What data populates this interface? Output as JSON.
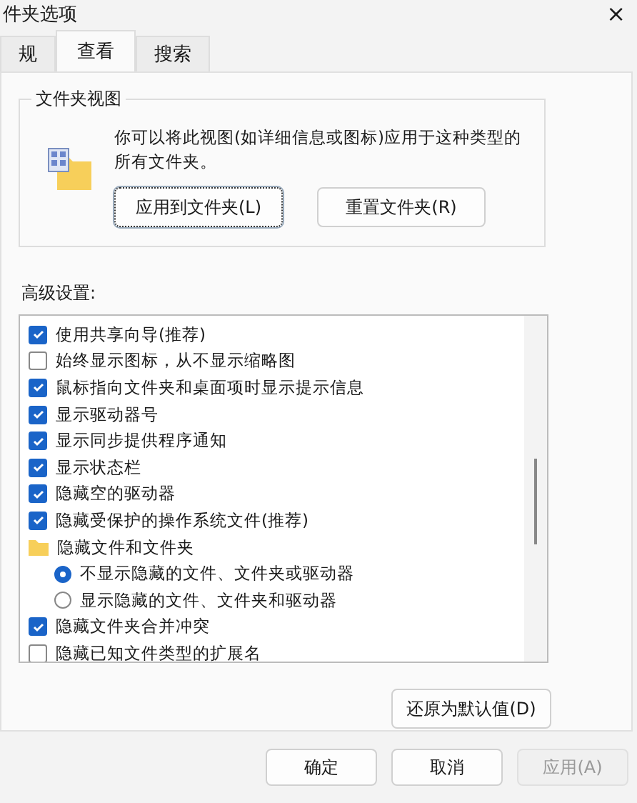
{
  "window": {
    "title": "件夹选项",
    "close": "×"
  },
  "tabs": [
    {
      "label": "规",
      "selected": false
    },
    {
      "label": "查看",
      "selected": true
    },
    {
      "label": "搜索",
      "selected": false
    }
  ],
  "folder_views": {
    "title": "文件夹视图",
    "description": "你可以将此视图(如详细信息或图标)应用于这种类型的所有文件夹。",
    "buttons": [
      "应用到文件夹(L)",
      "重置文件夹(R)"
    ]
  },
  "advanced": {
    "label": "高级设置:",
    "items": [
      {
        "kind": "checkbox",
        "label": "使用共享向导(推荐)",
        "checked": true
      },
      {
        "kind": "checkbox",
        "label": "始终显示图标，从不显示缩略图",
        "checked": false
      },
      {
        "kind": "checkbox",
        "label": "鼠标指向文件夹和桌面项时显示提示信息",
        "checked": true
      },
      {
        "kind": "checkbox",
        "label": "显示驱动器号",
        "checked": true
      },
      {
        "kind": "checkbox",
        "label": "显示同步提供程序通知",
        "checked": true
      },
      {
        "kind": "checkbox",
        "label": "显示状态栏",
        "checked": true
      },
      {
        "kind": "checkbox",
        "label": "隐藏空的驱动器",
        "checked": true
      },
      {
        "kind": "checkbox",
        "label": "隐藏受保护的操作系统文件(推荐)",
        "checked": true
      },
      {
        "kind": "folder",
        "label": "隐藏文件和文件夹",
        "children": [
          {
            "kind": "radio",
            "label": "不显示隐藏的文件、文件夹或驱动器",
            "selected": true
          },
          {
            "kind": "radio",
            "label": "显示隐藏的文件、文件夹和驱动器",
            "selected": false
          }
        ]
      },
      {
        "kind": "checkbox",
        "label": "隐藏文件夹合并冲突",
        "checked": true
      },
      {
        "kind": "checkbox",
        "label": "隐藏已知文件类型的扩展名",
        "checked": false
      }
    ],
    "restore_button": "还原为默认值(D)"
  },
  "footer": {
    "buttons": [
      {
        "label": "确定",
        "disabled": false
      },
      {
        "label": "取消",
        "disabled": false
      },
      {
        "label": "应用(A)",
        "disabled": true
      }
    ]
  }
}
